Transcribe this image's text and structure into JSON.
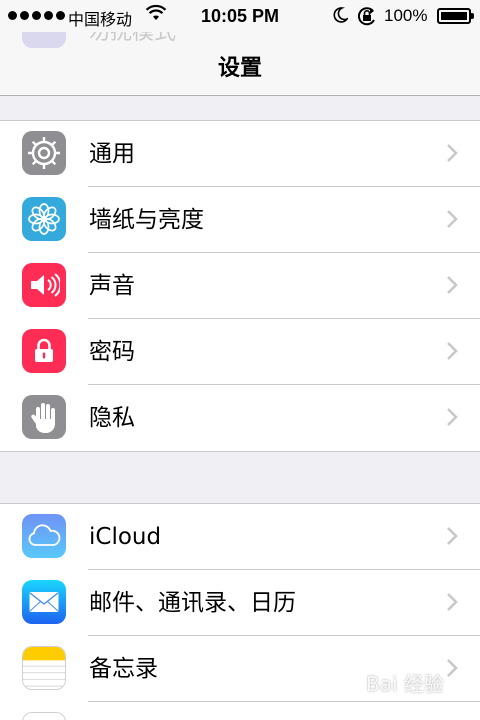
{
  "status_bar": {
    "carrier": "中国移动",
    "time": "10:05 PM",
    "battery_percent": "100%",
    "battery_level": 1.0,
    "icons": [
      "signal-dots-icon",
      "wifi-icon",
      "moon-icon",
      "rotation-lock-icon",
      "battery-icon"
    ]
  },
  "nav": {
    "title": "设置",
    "ghost_label": "勿扰模式"
  },
  "groups": [
    {
      "rows": [
        {
          "label": "通用",
          "icon": "gear-icon",
          "color": "#8e8e93"
        },
        {
          "label": "墙纸与亮度",
          "icon": "flower-icon",
          "color": "#34aadc"
        },
        {
          "label": "声音",
          "icon": "speaker-icon",
          "color": "#ff2d55"
        },
        {
          "label": "密码",
          "icon": "lock-icon",
          "color": "#ff2d55"
        },
        {
          "label": "隐私",
          "icon": "hand-icon",
          "color": "#8e8e93"
        }
      ]
    },
    {
      "rows": [
        {
          "label": "iCloud",
          "icon": "cloud-icon",
          "color": "#5ac8fa"
        },
        {
          "label": "邮件、通讯录、日历",
          "icon": "mail-icon",
          "color": "#1d9bf6"
        },
        {
          "label": "备忘录",
          "icon": "notes-icon",
          "color": "#ffcc00"
        }
      ]
    }
  ],
  "colors": {
    "background": "#efeff4",
    "chevron": "#c7c7cc",
    "separator": "#c8c7cc"
  },
  "watermark": "Bai 经验"
}
